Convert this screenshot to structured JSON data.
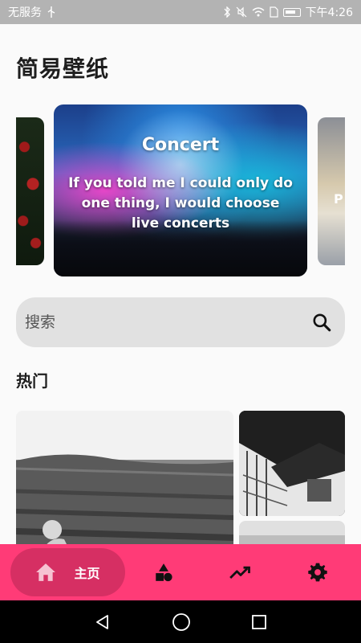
{
  "status_bar": {
    "carrier": "无服务",
    "time": "下午4:26",
    "icons": [
      "usb-icon",
      "bluetooth-icon",
      "mute-icon",
      "wifi-icon",
      "sim-icon",
      "battery-icon"
    ]
  },
  "app": {
    "title": "简易壁纸"
  },
  "carousel": {
    "cards": [
      {
        "position": "left-peek",
        "image": "roses"
      },
      {
        "position": "center",
        "image": "concert",
        "title": "Concert",
        "subtitle": "If you told me I could only do one thing, I would choose live concerts"
      },
      {
        "position": "right-peek",
        "image": "wall",
        "label": "P"
      }
    ]
  },
  "search": {
    "placeholder": "搜索"
  },
  "hot_section": {
    "title": "热门",
    "tiles": [
      {
        "image": "lavender-field"
      },
      {
        "image": "house"
      },
      {
        "image": "beach"
      }
    ]
  },
  "bottom_nav": {
    "items": [
      {
        "icon": "home-icon",
        "label": "主页",
        "selected": true
      },
      {
        "icon": "shapes-icon",
        "label": ""
      },
      {
        "icon": "trending-up-icon",
        "label": ""
      },
      {
        "icon": "gear-icon",
        "label": ""
      }
    ],
    "accent": "#ff3b77",
    "selected_bg": "#d62f63"
  },
  "system_nav": {
    "buttons": [
      "back-icon",
      "home-circle-icon",
      "recents-icon"
    ]
  }
}
